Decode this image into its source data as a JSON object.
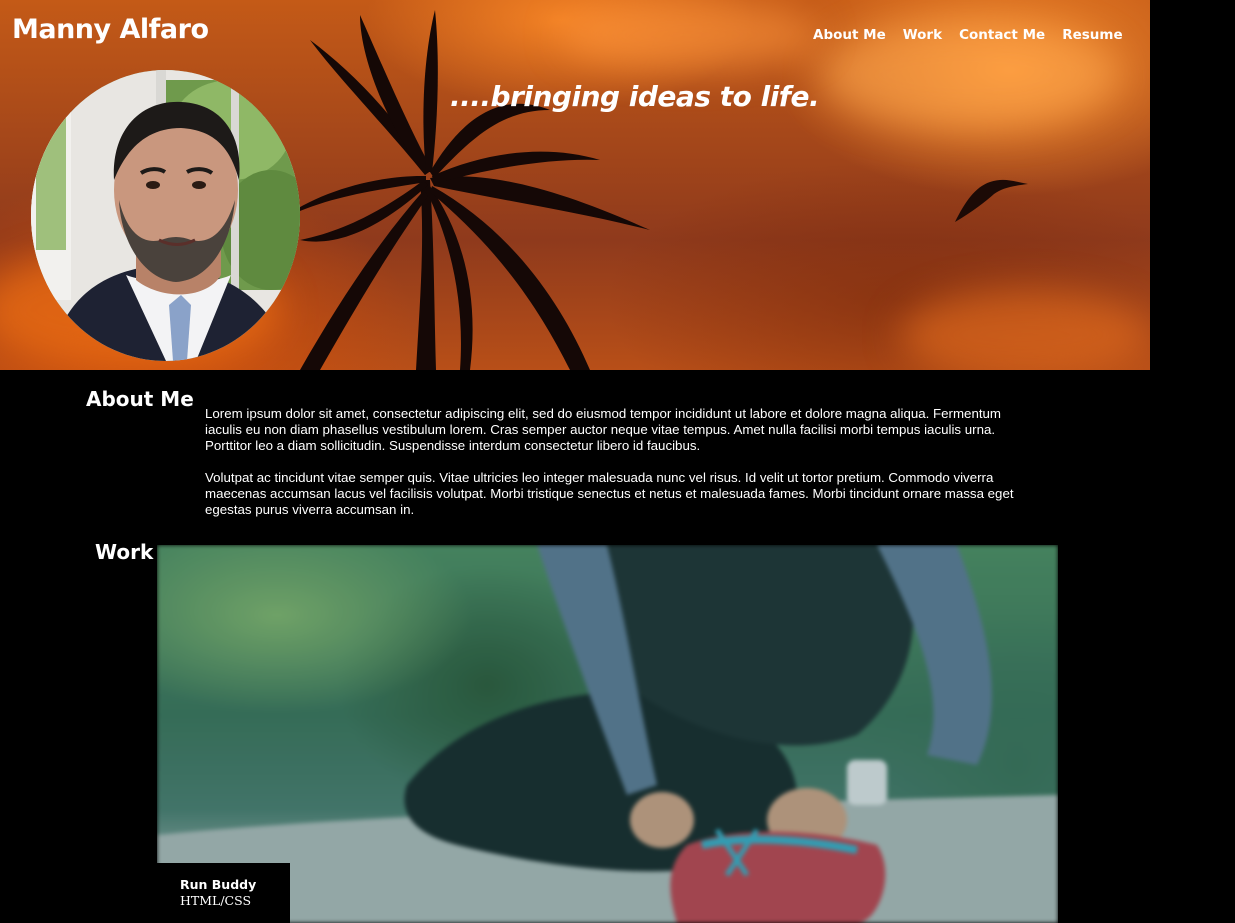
{
  "header": {
    "site_title": "Manny Alfaro",
    "nav": [
      {
        "label": "About Me"
      },
      {
        "label": "Work"
      },
      {
        "label": "Contact Me"
      },
      {
        "label": "Resume"
      }
    ],
    "tagline": "....bringing ideas to life."
  },
  "about": {
    "heading": "About Me",
    "paragraphs": [
      "Lorem ipsum dolor sit amet, consectetur adipiscing elit, sed do eiusmod tempor incididunt ut labore et dolore magna aliqua. Fermentum iaculis eu non diam phasellus vestibulum lorem. Cras semper auctor neque vitae tempus. Amet nulla facilisi morbi tempus iaculis urna. Porttitor leo a diam sollicitudin. Suspendisse interdum consectetur libero id faucibus.",
      "Volutpat ac tincidunt vitae semper quis. Vitae ultricies leo integer malesuada nunc vel risus. Id velit ut tortor pretium. Commodo viverra maecenas accumsan lacus vel facilisis volutpat. Morbi tristique senectus et netus et malesuada fames. Morbi tincidunt ornare massa eget egestas purus viverra accumsan in."
    ]
  },
  "work": {
    "heading": "Work",
    "projects": [
      {
        "name": "Run Buddy",
        "tech": "HTML/CSS"
      }
    ]
  },
  "colors": {
    "page_background": "#000000",
    "text": "#ffffff",
    "hero_orange": "#c45a17"
  }
}
